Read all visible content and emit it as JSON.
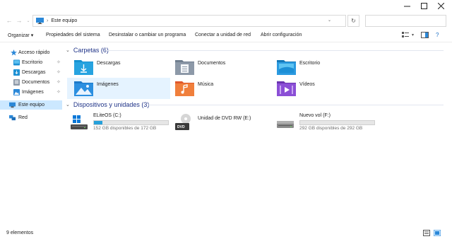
{
  "address": {
    "path": "Este equipo"
  },
  "commands": {
    "organize": "Organizar",
    "properties": "Propiedades del sistema",
    "uninstall": "Desinstalar o cambiar un programa",
    "map_network": "Conectar a unidad de red",
    "open_settings": "Abrir configuración"
  },
  "sidebar": {
    "quick_access": "Acceso rápido",
    "items": [
      {
        "label": "Escritorio",
        "icon": "desktop-folder-icon"
      },
      {
        "label": "Descargas",
        "icon": "downloads-folder-icon"
      },
      {
        "label": "Documentos",
        "icon": "documents-folder-icon"
      },
      {
        "label": "Imágenes",
        "icon": "pictures-folder-icon"
      }
    ],
    "this_pc": "Este equipo",
    "network": "Red"
  },
  "folders": {
    "header": "Carpetas (6)",
    "items": [
      {
        "label": "Descargas",
        "icon": "downloads-folder-icon"
      },
      {
        "label": "Documentos",
        "icon": "documents-folder-icon"
      },
      {
        "label": "Escritorio",
        "icon": "desktop-folder-icon"
      },
      {
        "label": "Imágenes",
        "icon": "pictures-folder-icon"
      },
      {
        "label": "Música",
        "icon": "music-folder-icon"
      },
      {
        "label": "Vídeos",
        "icon": "videos-folder-icon"
      }
    ]
  },
  "drives": {
    "header": "Dispositivos y unidades (3)",
    "items": [
      {
        "name": "ELiteOS (C:)",
        "free": "152 GB disponibles de 172 GB",
        "used_fraction": 0.116,
        "icon": "windows-drive-icon"
      },
      {
        "name": "Unidad de DVD RW (E:)",
        "icon": "dvd-drive-icon",
        "badge": "DVD"
      },
      {
        "name": "Nuevo vol (F:)",
        "free": "292 GB disponibles de 292 GB",
        "used_fraction": 0.0,
        "icon": "hard-drive-icon"
      }
    ]
  },
  "status": {
    "count": "9 elementos"
  },
  "colors": {
    "accent": "#26a0da",
    "selected": "#cce8ff",
    "header": "#1e3287"
  }
}
